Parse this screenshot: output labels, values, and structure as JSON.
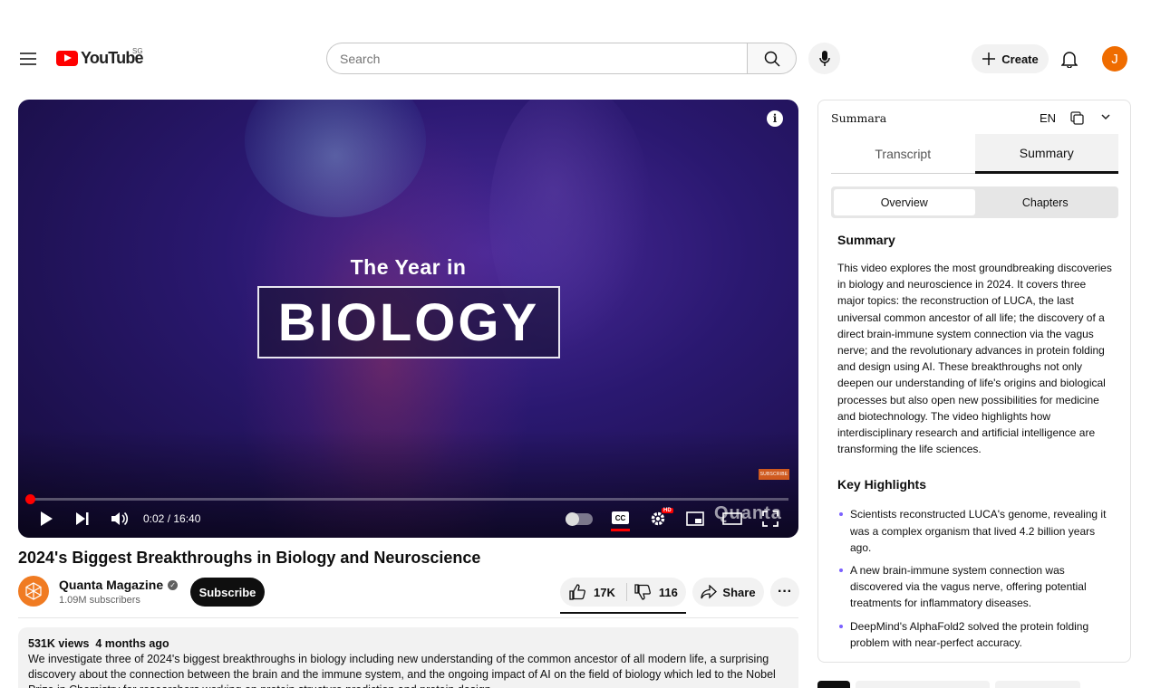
{
  "header": {
    "logo_text": "YouTube",
    "country_code": "SG",
    "search_placeholder": "Search",
    "create_label": "Create",
    "avatar_initial": "J",
    "icons": [
      "hamburger-menu-icon",
      "search-icon",
      "microphone-icon",
      "plus-icon",
      "bell-icon"
    ]
  },
  "player": {
    "overlay_subtitle": "The Year in",
    "overlay_title": "BIOLOGY",
    "subscribe_badge": "SUBSCRIBE",
    "watermark": "Quanta",
    "time_display": "0:02 / 16:40",
    "progress_fraction": 0.002,
    "cc_label": "CC",
    "hd_badge": "HD",
    "icons": [
      "info-icon",
      "play-icon",
      "next-icon",
      "volume-icon",
      "autoplay-toggle",
      "cc-icon",
      "settings-icon",
      "miniplayer-icon",
      "theater-icon",
      "fullscreen-icon"
    ]
  },
  "video": {
    "title": "2024's Biggest Breakthroughs in Biology and Neuroscience",
    "channel_name": "Quanta Magazine",
    "subscribers": "1.09M subscribers",
    "subscribe_label": "Subscribe",
    "likes": "17K",
    "dislikes": "116",
    "share_label": "Share",
    "more_label": "···",
    "views": "531K views",
    "age": "4 months ago",
    "description": "We investigate three of 2024's biggest breakthroughs in biology including new understanding of the common ancestor of all modern life, a surprising discovery about the connection between the brain and the immune system, and the ongoing impact of AI on the field of biology which led to the Nobel Prize in Chemistry for researchers working on protein structure prediction and protein design."
  },
  "summara": {
    "brand": "Summara",
    "language": "EN",
    "tabs": [
      "Transcript",
      "Summary"
    ],
    "active_tab": "Summary",
    "segments": [
      "Overview",
      "Chapters"
    ],
    "active_segment": "Overview",
    "summary_heading": "Summary",
    "summary_text": "This video explores the most groundbreaking discoveries in biology and neuroscience in 2024. It covers three major topics: the reconstruction of LUCA, the last universal common ancestor of all life; the discovery of a direct brain-immune system connection via the vagus nerve; and the revolutionary advances in protein folding and design using AI. These breakthroughs not only deepen our understanding of life's origins and biological processes but also open new possibilities for medicine and biotechnology. The video highlights how interdisciplinary research and artificial intelligence are transforming the life sciences.",
    "highlights_heading": "Key Highlights",
    "highlights": [
      "Scientists reconstructed LUCA's genome, revealing it was a complex organism that lived 4.2 billion years ago.",
      "A new brain-immune system connection was discovered via the vagus nerve, offering potential treatments for inflammatory diseases.",
      "DeepMind's AlphaFold2 solved the protein folding problem with near-perfect accuracy."
    ],
    "accent_color": "#7b61ff"
  }
}
